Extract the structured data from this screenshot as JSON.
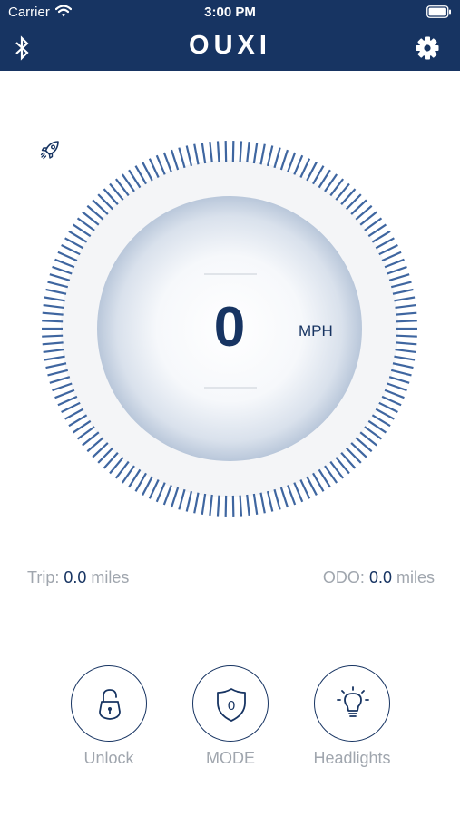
{
  "status_bar": {
    "carrier": "Carrier",
    "time": "3:00 PM"
  },
  "nav": {
    "title": "OUXI"
  },
  "gauge": {
    "speed": "0",
    "unit": "MPH"
  },
  "stats": {
    "trip_label": "Trip:",
    "trip_value": "0.0",
    "trip_unit": "miles",
    "odo_label": "ODO:",
    "odo_value": "0.0",
    "odo_unit": "miles"
  },
  "controls": [
    {
      "label": "Unlock",
      "icon": "unlock-icon"
    },
    {
      "label": "MODE",
      "icon": "mode-shield-icon",
      "badge": "0"
    },
    {
      "label": "Headlights",
      "icon": "headlight-bulb-icon"
    }
  ],
  "colors": {
    "header": "#173462",
    "accent": "#173462",
    "muted_text": "#a0a6ae",
    "tick": "#3f66a0"
  }
}
